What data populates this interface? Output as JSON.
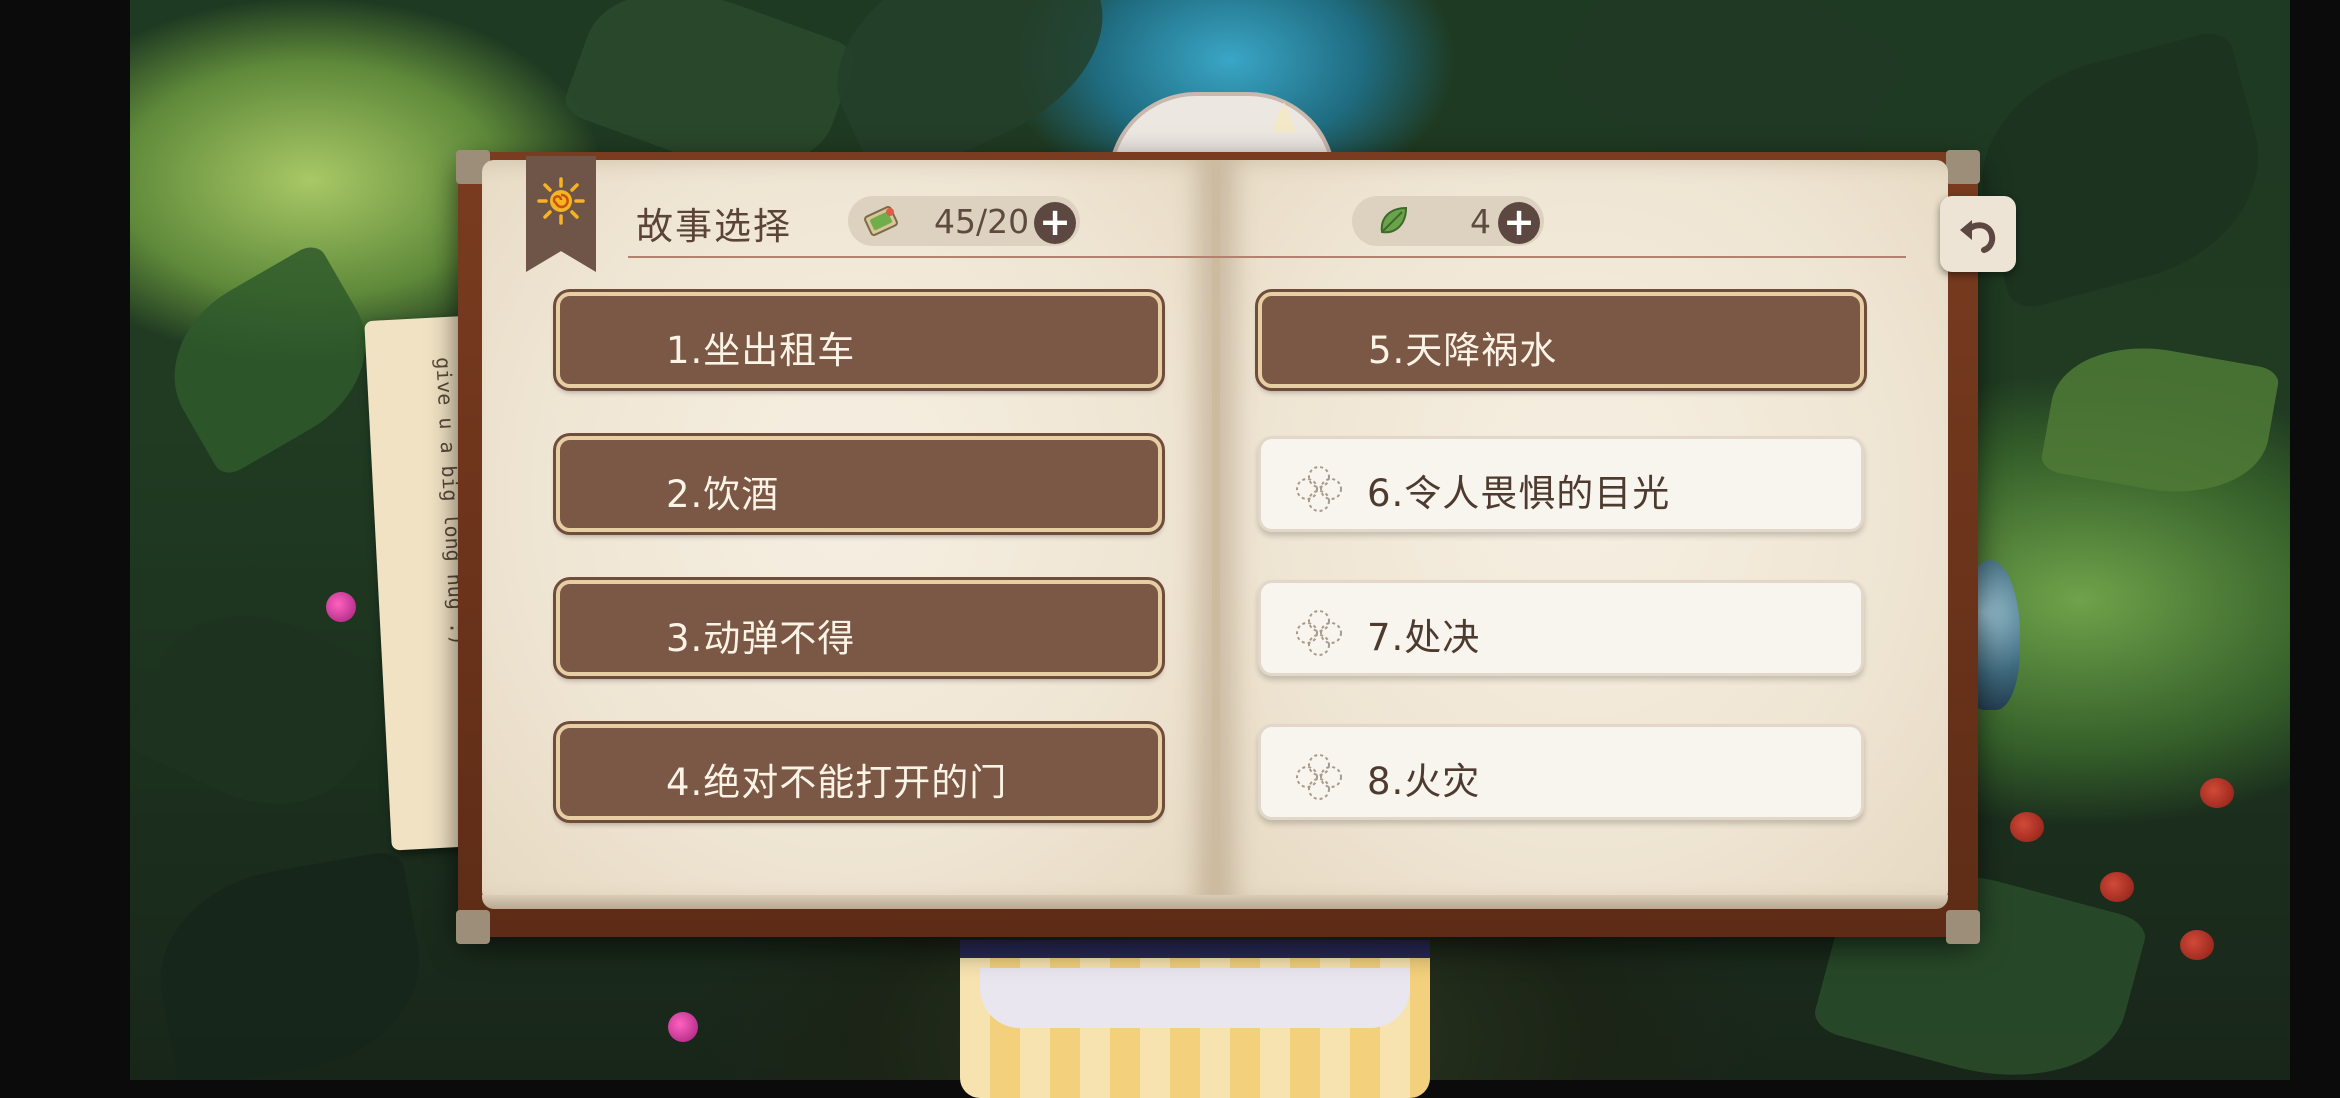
{
  "header": {
    "title": "故事选择",
    "tickets": {
      "value": "45/20",
      "icon": "ticket-icon"
    },
    "leaves": {
      "value": "4",
      "icon": "leaf-icon"
    }
  },
  "stories_left": [
    {
      "label": "1.坐出租车",
      "locked": false
    },
    {
      "label": "2.饮酒",
      "locked": false
    },
    {
      "label": "3.动弹不得",
      "locked": false
    },
    {
      "label": "4.绝对不能打开的门",
      "locked": false
    }
  ],
  "stories_right": [
    {
      "label": "5.天降祸水",
      "locked": false
    },
    {
      "label": "6.令人畏惧的目光",
      "locked": true
    },
    {
      "label": "7.处决",
      "locked": true
    },
    {
      "label": "8.火灾",
      "locked": true
    }
  ],
  "background_note": "give u a big long hug :)",
  "colors": {
    "unlocked_button": "#7b5746",
    "locked_button": "#f8f4ee",
    "page": "#f6efe2",
    "book_cover": "#7a3c20"
  }
}
